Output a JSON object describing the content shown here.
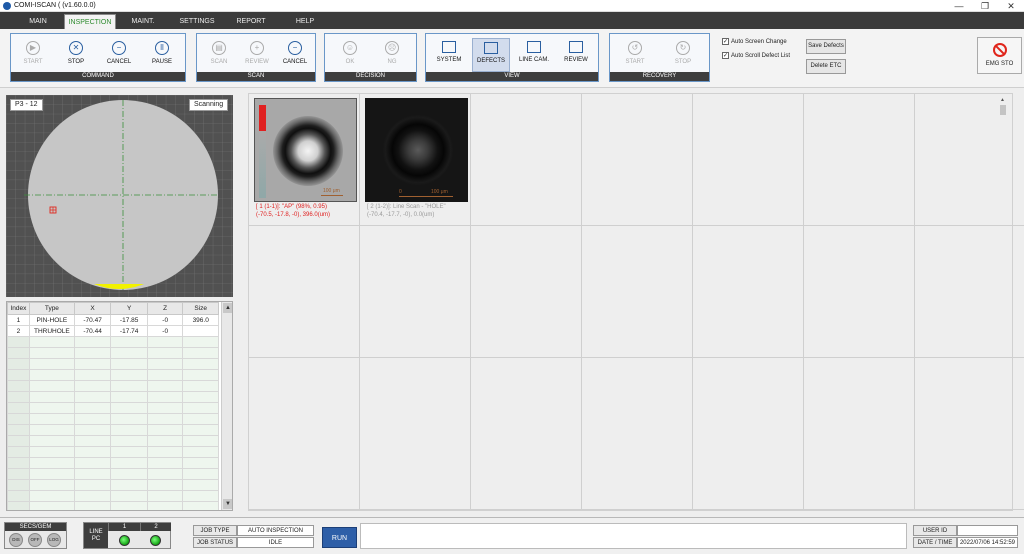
{
  "window": {
    "title": "COMI-ISCAN ( (v1.60.0.0)",
    "controls": [
      "—",
      "❐",
      "✕"
    ]
  },
  "menu": [
    "MAIN",
    "INSPECTION",
    "MAINT.",
    "SETTINGS",
    "REPORT",
    "HELP"
  ],
  "menu_active": "INSPECTION",
  "toolbar": {
    "command": {
      "caption": "COMMAND",
      "buttons": [
        {
          "label": "START",
          "icon": "play-icon",
          "enabled": false
        },
        {
          "label": "STOP",
          "icon": "stop-icon",
          "enabled": true
        },
        {
          "label": "CANCEL",
          "icon": "cancel-icon",
          "enabled": true
        },
        {
          "label": "PAUSE",
          "icon": "pause-icon",
          "enabled": true
        }
      ]
    },
    "scan": {
      "caption": "SCAN",
      "buttons": [
        {
          "label": "SCAN",
          "icon": "scan-icon",
          "enabled": false
        },
        {
          "label": "REVIEW",
          "icon": "zoom-in-icon",
          "enabled": false
        },
        {
          "label": "CANCEL",
          "icon": "zoom-out-icon",
          "enabled": true
        }
      ]
    },
    "decision": {
      "caption": "DECISION",
      "buttons": [
        {
          "label": "OK",
          "icon": "smile-icon",
          "enabled": false
        },
        {
          "label": "NG",
          "icon": "frown-icon",
          "enabled": false
        }
      ]
    },
    "view": {
      "caption": "VIEW",
      "buttons": [
        {
          "label": "SYSTEM",
          "icon": "system-icon",
          "enabled": true
        },
        {
          "label": "DEFECTS",
          "icon": "defects-icon",
          "enabled": true,
          "selected": true
        },
        {
          "label": "LINE CAM.",
          "icon": "line-camera-icon",
          "enabled": true
        },
        {
          "label": "REVIEW",
          "icon": "review-icon",
          "enabled": true
        }
      ]
    },
    "recovery": {
      "caption": "RECOVERY",
      "buttons": [
        {
          "label": "START",
          "icon": "recovery-start-icon",
          "enabled": false
        },
        {
          "label": "STOP",
          "icon": "recovery-stop-icon",
          "enabled": false
        }
      ]
    },
    "auto_screen_change": "Auto Screen Change",
    "auto_scroll": "Auto Scroll Defect List",
    "auto_screen_checked": true,
    "auto_scroll_checked": true,
    "save_defects": "Save Defects",
    "delete_etc": "Delete ETC",
    "emg_stop": "EMG STO"
  },
  "wafer": {
    "position_label": "P3 - 12",
    "status_label": "Scanning",
    "defect_mark_color": "#e0261c",
    "flat_color": "#f2f200"
  },
  "defect_table": {
    "headers": [
      "Index",
      "Type",
      "X",
      "Y",
      "Z",
      "Size"
    ],
    "rows": [
      [
        "1",
        "PIN-HOLE",
        "-70.47",
        "-17.85",
        "-0",
        "396.0"
      ],
      [
        "2",
        "THRUHOLE",
        "-70.44",
        "-17.74",
        "-0",
        ""
      ]
    ]
  },
  "gallery": {
    "items": [
      {
        "scale_label": "100 μm",
        "caption1": "[ 1 (1-1)]: \"AP\" (98%, 0.95)",
        "caption2": "(-70.5, -17.8, -0), 396.0(um)",
        "caption_color": "#e02020"
      },
      {
        "scale_label": "100 μm",
        "scale_zero": "0",
        "caption1": "[ 2 (1-2)]: Line Scan - \"HOLE\"",
        "caption2": "(-70.4, -17.7, -0), 0.0(um)",
        "caption_color": "#999999"
      }
    ]
  },
  "status": {
    "secs_title": "SECS/GEM",
    "secs_buttons": [
      "DIS",
      "OFF",
      "LOG"
    ],
    "line_pc": "LINE\nPC",
    "line_cols": [
      "1",
      "2"
    ],
    "job_type_label": "JOB TYPE",
    "job_type_value": "AUTO INSPECTION",
    "job_status_label": "JOB STATUS",
    "job_status_value": "IDLE",
    "run": "RUN",
    "user_id_label": "USER ID",
    "user_id_value": "",
    "datetime_label": "DATE / TIME",
    "datetime_value": "2022/07/06 14:52:59"
  }
}
